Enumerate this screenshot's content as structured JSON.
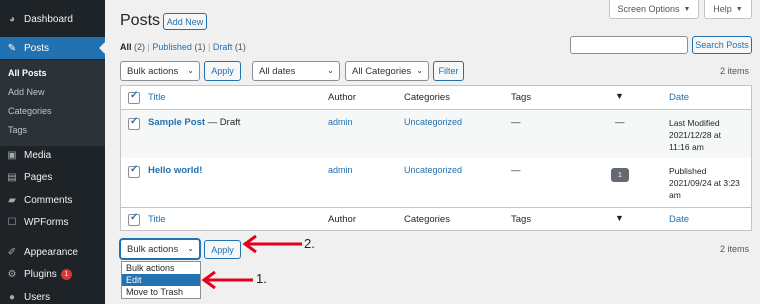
{
  "sidebar": {
    "items": [
      {
        "label": "Dashboard",
        "icon": "dashboard-icon"
      },
      {
        "label": "Posts",
        "icon": "pin-icon"
      },
      {
        "label": "Media",
        "icon": "media-icon"
      },
      {
        "label": "Pages",
        "icon": "pages-icon"
      },
      {
        "label": "Comments",
        "icon": "comments-icon"
      },
      {
        "label": "WPForms",
        "icon": "forms-icon"
      },
      {
        "label": "Appearance",
        "icon": "appearance-icon"
      },
      {
        "label": "Plugins",
        "icon": "plugins-icon",
        "badge": "1"
      },
      {
        "label": "Users",
        "icon": "users-icon"
      }
    ],
    "submenu": [
      "All Posts",
      "Add New",
      "Categories",
      "Tags"
    ]
  },
  "header": {
    "title": "Posts",
    "add_new": "Add New",
    "screen_options": "Screen Options",
    "help": "Help"
  },
  "filters": {
    "all": "All",
    "all_count": "(2)",
    "published": "Published",
    "published_count": "(1)",
    "draft": "Draft",
    "draft_count": "(1)",
    "sep": "|"
  },
  "search": {
    "value": "",
    "button": "Search Posts"
  },
  "toolbar": {
    "bulk_actions": "Bulk actions",
    "apply": "Apply",
    "dates": "All dates",
    "categories": "All Categories",
    "filter": "Filter",
    "items_count": "2 items"
  },
  "table": {
    "columns": {
      "title": "Title",
      "author": "Author",
      "categories": "Categories",
      "tags": "Tags",
      "date": "Date"
    },
    "rows": [
      {
        "title": "Sample Post",
        "state": " — Draft",
        "author": "admin",
        "category": "Uncategorized",
        "tags": "—",
        "comments": "—",
        "date_status": "Last Modified",
        "date_day": "2021/12/28 at",
        "date_time": "11:16 am"
      },
      {
        "title": "Hello world!",
        "state": "",
        "author": "admin",
        "category": "Uncategorized",
        "tags": "—",
        "comments": "1",
        "date_status": "Published",
        "date_day": "2021/09/24 at 3:23",
        "date_time": "am"
      }
    ]
  },
  "bottom": {
    "bulk_actions": "Bulk actions",
    "apply": "Apply",
    "items_count": "2 items",
    "dropdown_options": [
      "Bulk actions",
      "Edit",
      "Move to Trash"
    ]
  },
  "annotations": {
    "step1": "1.",
    "step2": "2.",
    "color": "#e2001a"
  },
  "colors": {
    "accent": "#2271b1",
    "sidebar": "#1d2327",
    "badge": "#d63638"
  }
}
